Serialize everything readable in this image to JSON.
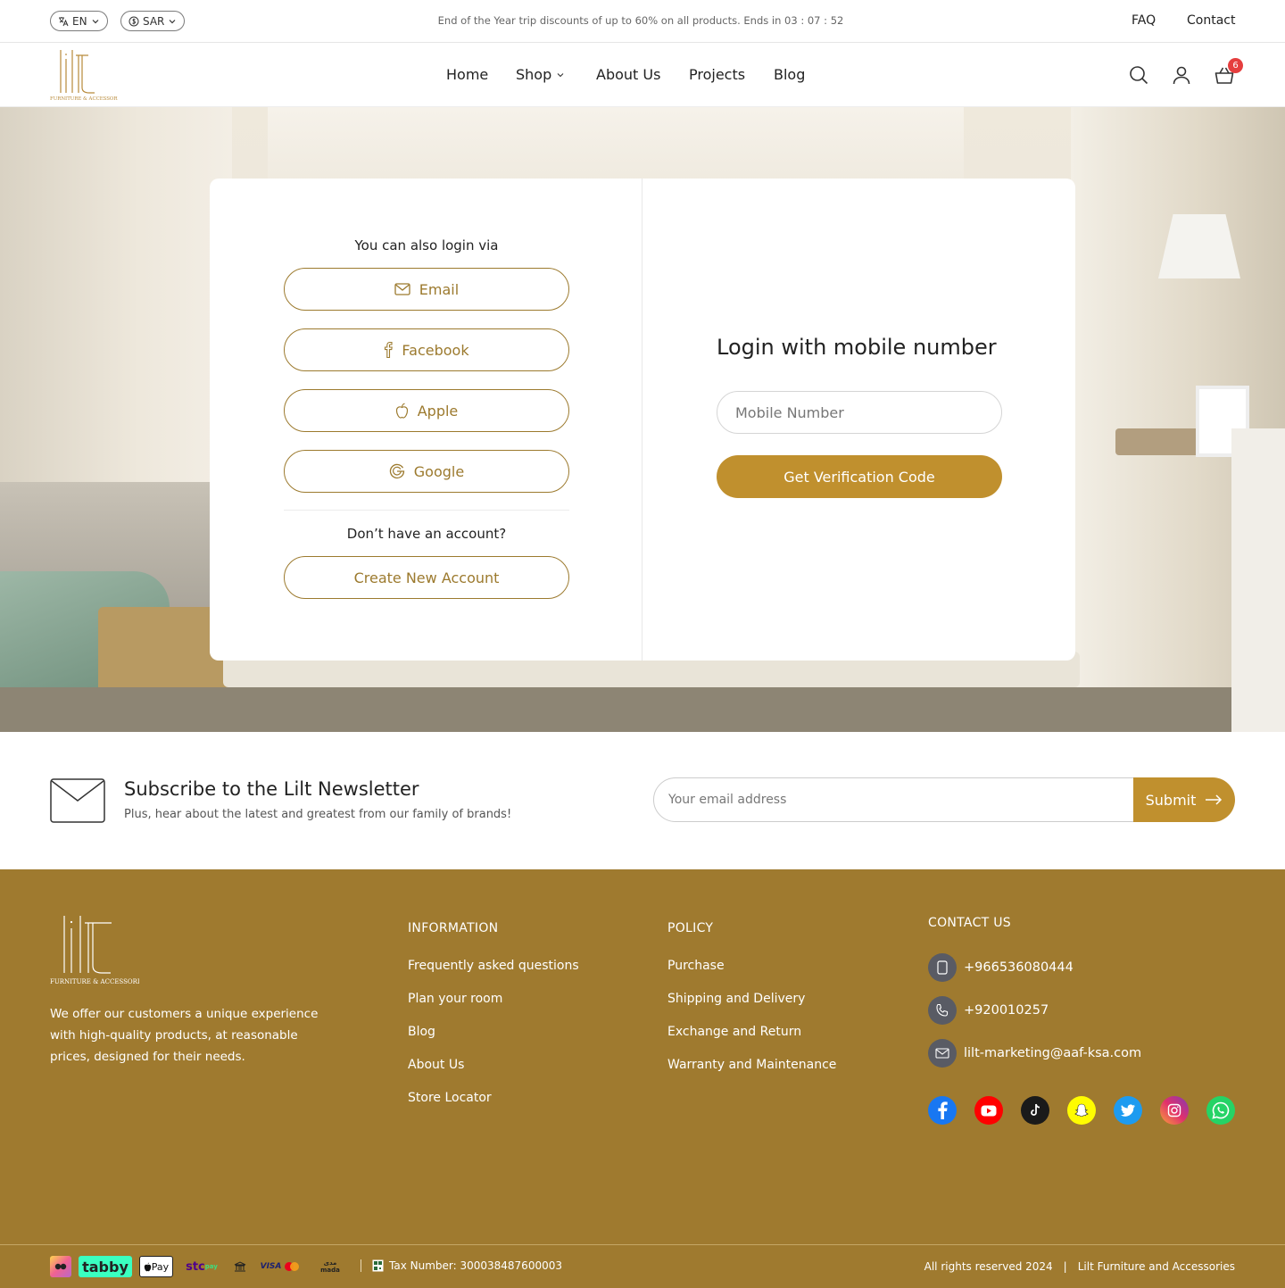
{
  "topbar": {
    "language": "EN",
    "currency": "SAR",
    "promo": "End of the Year trip discounts of up to 60% on all products. Ends in 03 : 07 : 52",
    "faq": "FAQ",
    "contact": "Contact"
  },
  "header": {
    "logo_text": "lilt",
    "logo_sub": "FURNITURE & ACCESSORIES",
    "nav": [
      "Home",
      "Shop",
      "About Us",
      "Projects",
      "Blog"
    ],
    "cart_count": "6"
  },
  "login": {
    "via_title": "You can also login via",
    "providers": [
      "Email",
      "Facebook",
      "Apple",
      "Google"
    ],
    "no_account": "Don’t have an account?",
    "create_account": "Create New Account",
    "mobile_title": "Login with mobile number",
    "mobile_placeholder": "Mobile Number",
    "verify_button": "Get Verification Code"
  },
  "newsletter": {
    "title": "Subscribe to the Lilt Newsletter",
    "subtitle": "Plus, hear about the latest and greatest from our family of brands!",
    "placeholder": "Your email address",
    "submit": "Submit"
  },
  "footer": {
    "about": "We offer our customers a unique experience with high-quality products, at reasonable prices, designed for their needs.",
    "information": {
      "heading": "INFORMATION",
      "links": [
        "Frequently asked questions",
        "Plan your room",
        "Blog",
        "About Us",
        "Store Locator"
      ]
    },
    "policy": {
      "heading": "POLICY",
      "links": [
        "Purchase",
        "Shipping and Delivery",
        "Exchange and Return",
        "Warranty and Maintenance"
      ]
    },
    "contact": {
      "heading": "CONTACT US",
      "mobile": "+966536080444",
      "phone": "+920010257",
      "email": "lilt-marketing@aaf-ksa.com"
    },
    "social": [
      "facebook-icon",
      "youtube-icon",
      "tiktok-icon",
      "snapchat-icon",
      "twitter-icon",
      "instagram-icon",
      "whatsapp-icon"
    ],
    "payments": {
      "tabby": "tabby",
      "applepay": "Pay",
      "stc": "stc",
      "stc_pay": "pay",
      "visa": "VISA",
      "mastercard": "MasterCard",
      "mada_ar": "مدى",
      "mada": "mada"
    },
    "tax": "Tax Number: 300038487600003",
    "rights": "All rights reserved 2024",
    "separator": "|",
    "company": "Lilt Furniture and Accessories"
  },
  "colors": {
    "brand": "#c0902e",
    "brand_text": "#9c7a2e",
    "footer_bg": "#9f7a2f",
    "badge": "#e53e3e"
  }
}
